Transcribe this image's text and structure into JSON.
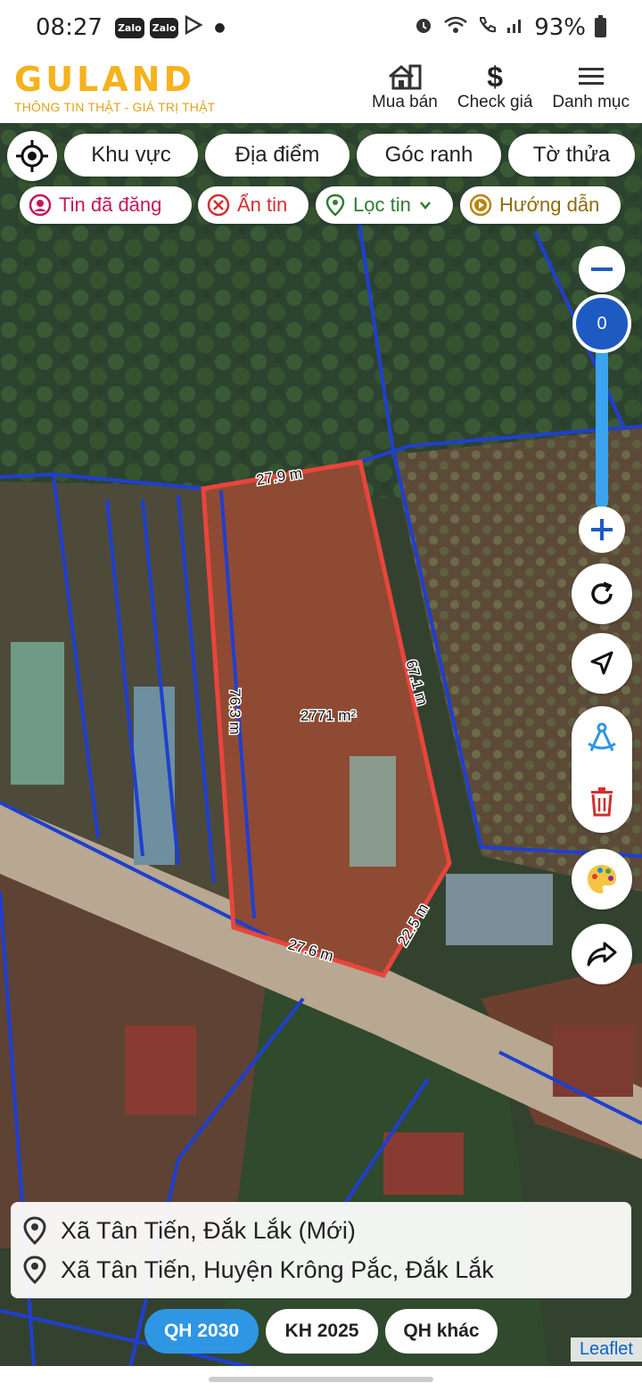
{
  "status": {
    "time": "08:27",
    "zalo1": "Zalo",
    "zalo2": "Zalo",
    "battery": "93%"
  },
  "header": {
    "brand": "GULAND",
    "tagline": "THÔNG TIN THẬT - GIÁ TRỊ THẬT",
    "nav": [
      {
        "label": "Mua bán",
        "icon": "house-icon"
      },
      {
        "label": "Check giá",
        "icon": "dollar-icon"
      },
      {
        "label": "Danh mục",
        "icon": "menu-icon"
      }
    ]
  },
  "filters": {
    "khu_vuc": "Khu vực",
    "dia_diem": "Địa điểm",
    "goc_ranh": "Góc ranh",
    "to_thua": "Tờ thửa"
  },
  "actions": {
    "tin_da_dang": "Tin đã đăng",
    "an_tin": "Ẩn tin",
    "loc_tin": "Lọc tin",
    "huong_dan": "Hướng dẫn"
  },
  "zoom": {
    "value": "0"
  },
  "parcel": {
    "area": "2771 m²",
    "top": "27.9 m",
    "left": "76.3 m",
    "right": "67.1 m",
    "bottom": "27.6 m",
    "bottom_right": "22.5 m"
  },
  "address": {
    "line1": "Xã Tân Tiến, Đắk Lắk (Mới)",
    "line2": "Xã Tân Tiến, Huyện Krông Pắc, Đắk Lắk"
  },
  "tabs": [
    {
      "label": "QH 2030",
      "active": true
    },
    {
      "label": "KH 2025",
      "active": false
    },
    {
      "label": "QH khác",
      "active": false
    }
  ],
  "attribution": "Leaflet",
  "colors": {
    "brand": "#f5b21b",
    "parcel": "#e8453c",
    "boundary": "#1f3fd1",
    "active_tab": "#2f96e4"
  }
}
